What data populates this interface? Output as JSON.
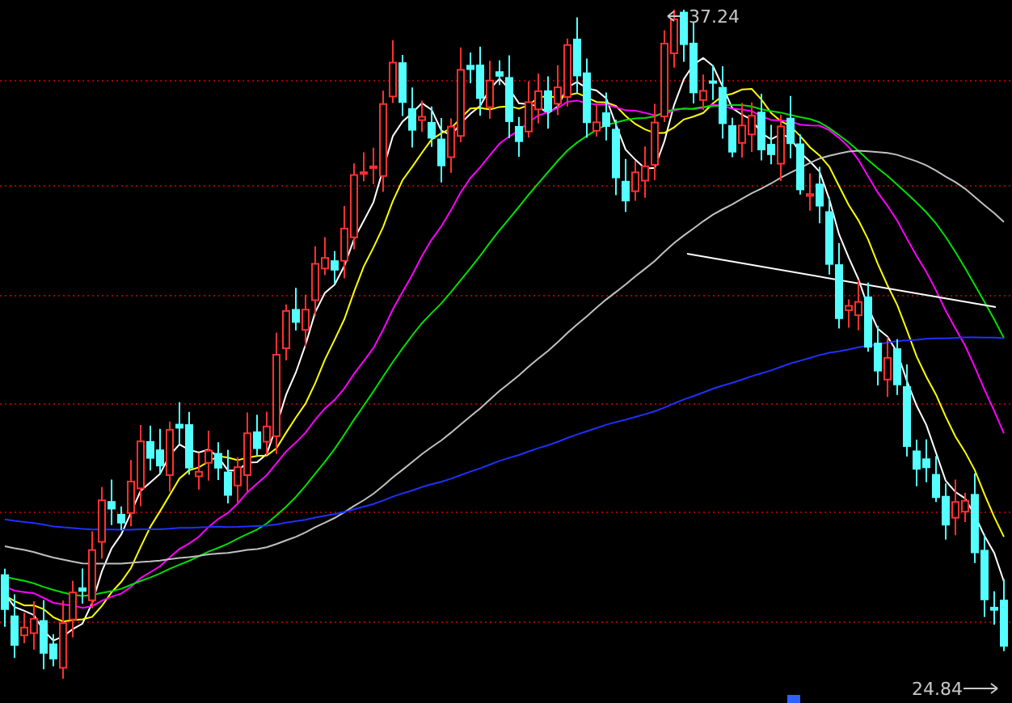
{
  "chart": {
    "high_label": "37.24",
    "low_label": "24.84"
  }
}
